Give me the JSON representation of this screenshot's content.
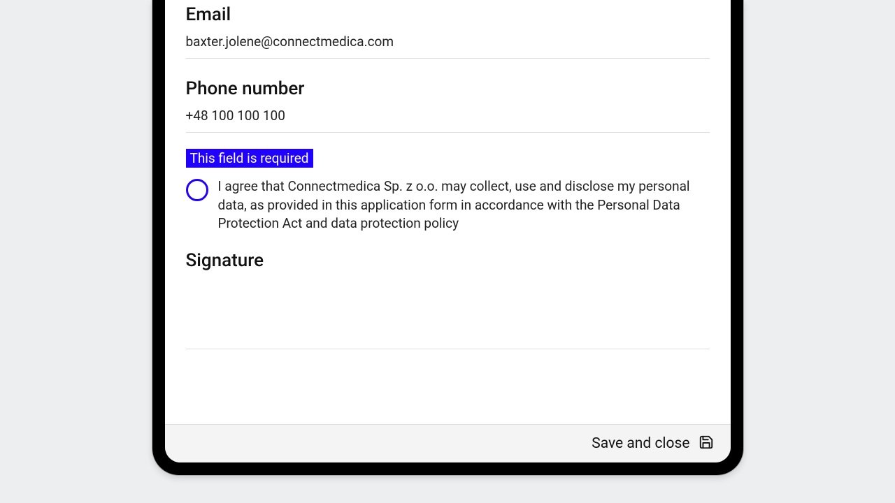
{
  "form": {
    "email": {
      "label": "Email",
      "value": "baxter.jolene@connectmedica.com"
    },
    "phone": {
      "label": "Phone number",
      "value": "+48 100 100 100"
    },
    "consent": {
      "error": "This field is required",
      "text": "I agree that Connectmedica Sp. z o.o. may collect, use and disclose my personal data, as provided in this application form in accordance with the Personal Data Protection Act and data protection policy",
      "checked": false
    },
    "signature": {
      "label": "Signature"
    }
  },
  "footer": {
    "save_label": "Save and close"
  },
  "colors": {
    "accent": "#2000ff"
  }
}
